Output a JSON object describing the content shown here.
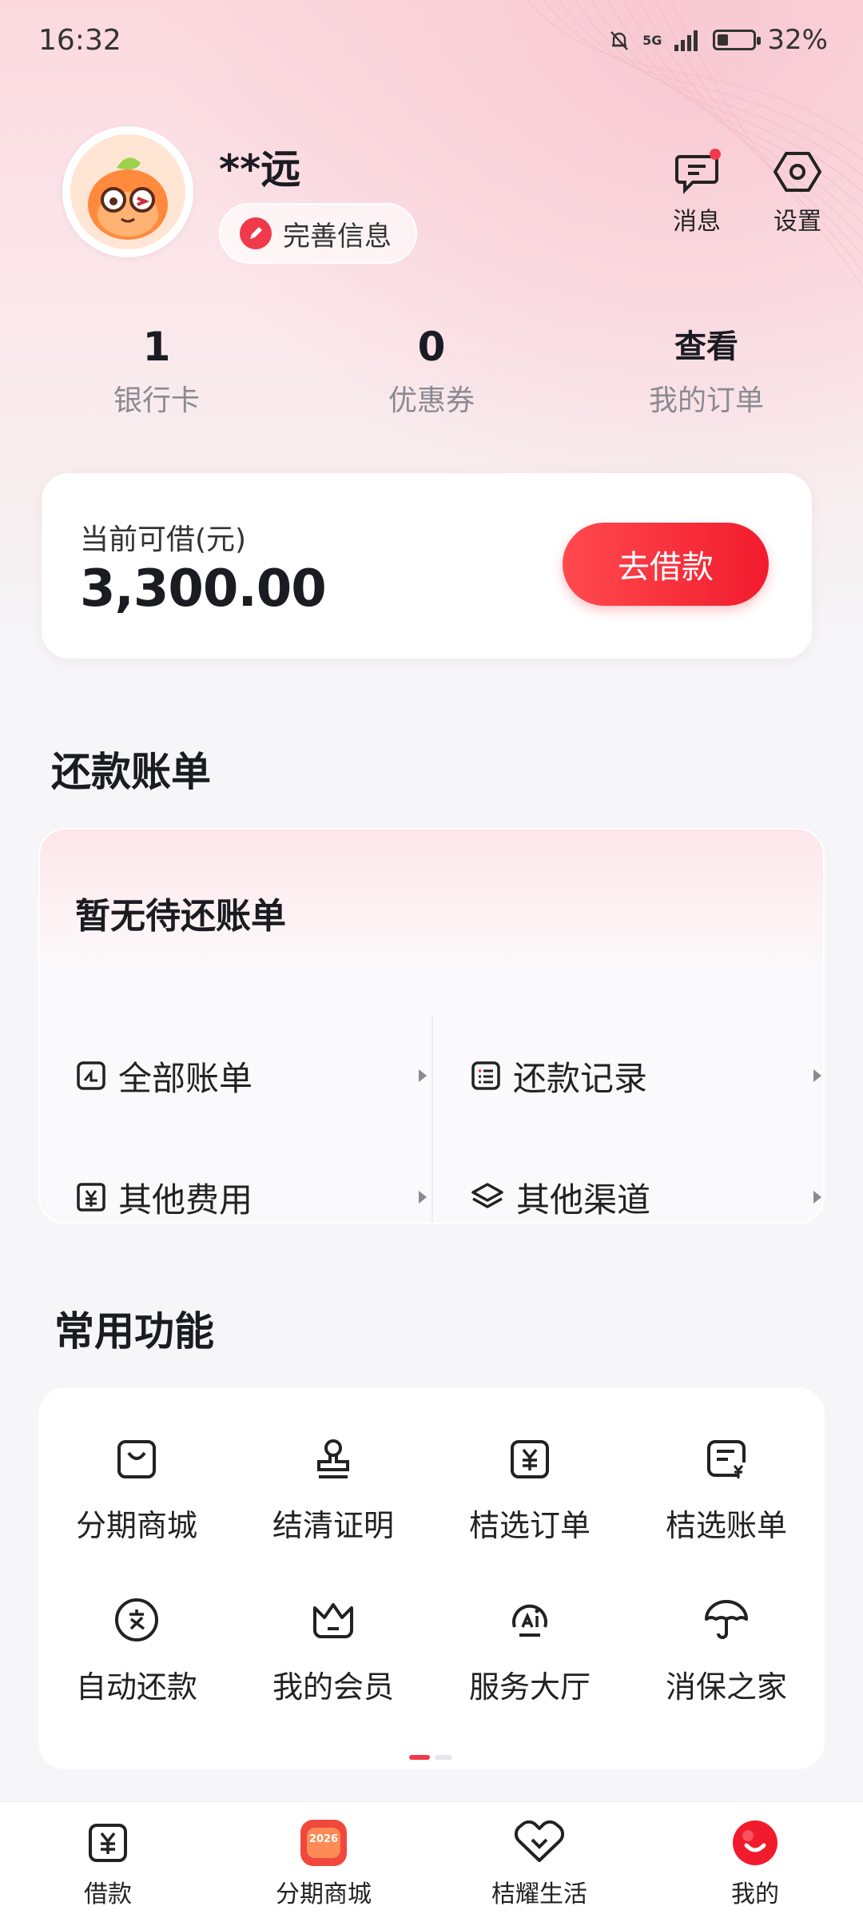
{
  "status_bar": {
    "time": "16:32",
    "network": "5G",
    "battery": "32%",
    "battery_level": 0.32
  },
  "profile": {
    "username": "**远",
    "edit_info_label": "完善信息"
  },
  "header_actions": {
    "messages_label": "消息",
    "settings_label": "设置"
  },
  "stats": [
    {
      "value": "1",
      "label": "银行卡"
    },
    {
      "value": "0",
      "label": "优惠券"
    },
    {
      "value": "查看",
      "label": "我的订单"
    }
  ],
  "borrow": {
    "label": "当前可借(元)",
    "amount": "3,300.00",
    "button_label": "去借款"
  },
  "repayment": {
    "section_title": "还款账单",
    "empty_text": "暂无待还账单",
    "items": [
      {
        "label": "全部账单",
        "icon": "bill-icon"
      },
      {
        "label": "还款记录",
        "icon": "record-list-icon"
      },
      {
        "label": "其他费用",
        "icon": "fee-icon"
      },
      {
        "label": "其他渠道",
        "icon": "layers-icon"
      }
    ]
  },
  "functions": {
    "section_title": "常用功能",
    "items": [
      {
        "label": "分期商城",
        "icon": "shopping-bag-icon"
      },
      {
        "label": "结清证明",
        "icon": "stamp-icon"
      },
      {
        "label": "桔选订单",
        "icon": "yuan-order-icon"
      },
      {
        "label": "桔选账单",
        "icon": "yuan-bill-icon"
      },
      {
        "label": "自动还款",
        "icon": "auto-repay-icon"
      },
      {
        "label": "我的会员",
        "icon": "crown-icon"
      },
      {
        "label": "服务大厅",
        "icon": "ai-service-icon"
      },
      {
        "label": "消保之家",
        "icon": "umbrella-icon"
      }
    ],
    "page_index": 1,
    "page_count": 2
  },
  "bottom_nav": [
    {
      "label": "借款",
      "icon": "yuan-icon"
    },
    {
      "label": "分期商城",
      "icon": "mall-2026-icon",
      "badge_text": "2026"
    },
    {
      "label": "桔耀生活",
      "icon": "heart-chevron-icon"
    },
    {
      "label": "我的",
      "icon": "me-icon",
      "active": true
    }
  ],
  "colors": {
    "accent": "#f21b2d",
    "text": "#1b1b22",
    "muted": "#8a8a92"
  }
}
